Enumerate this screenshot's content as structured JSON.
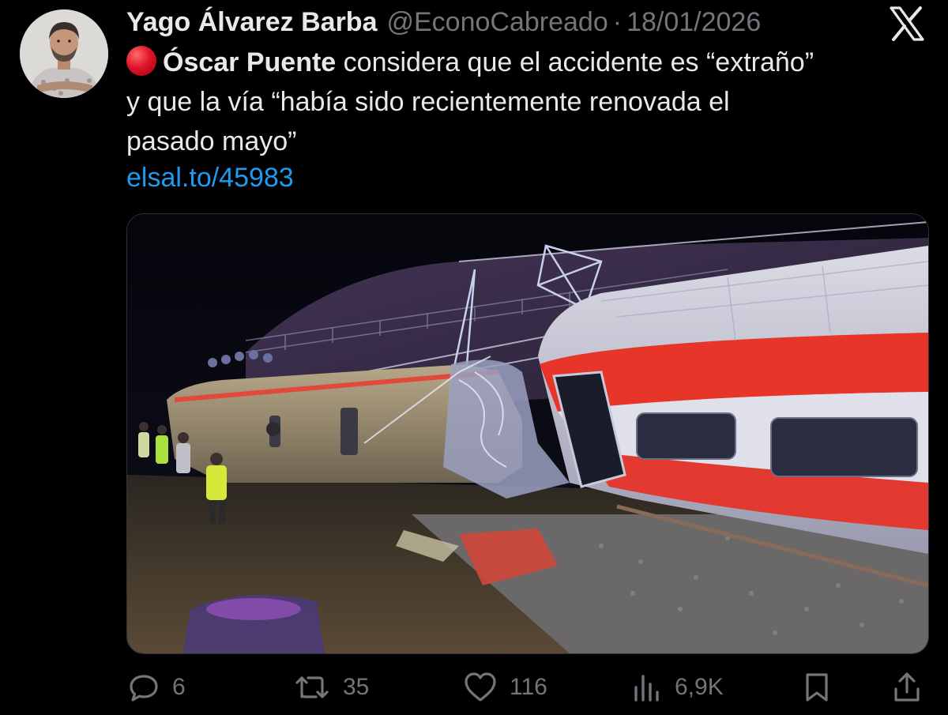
{
  "author": {
    "display_name": "Yago Álvarez Barba",
    "handle": "@EconoCabreado",
    "separator": "·",
    "date": "18/01/2026"
  },
  "tweet": {
    "mention": "Óscar Puente",
    "text_part1": " considera que el accidente es “extraño”",
    "text_part2": "y que la vía “había sido recientemente renovada el",
    "text_part3": "pasado mayo”",
    "link": "elsal.to/45983",
    "status_emoji_icon": "red-circle-icon"
  },
  "media": {
    "icon": "train-accident-photo"
  },
  "actions": {
    "replies": "6",
    "reposts": "35",
    "likes": "116",
    "views": "6,9K",
    "icons": [
      "reply-icon",
      "repost-icon",
      "like-icon",
      "views-icon",
      "bookmark-icon",
      "share-icon"
    ]
  },
  "colors": {
    "background": "#000000",
    "text": "#e7e9ea",
    "secondary": "#71767b",
    "link": "#1d9bf0"
  }
}
